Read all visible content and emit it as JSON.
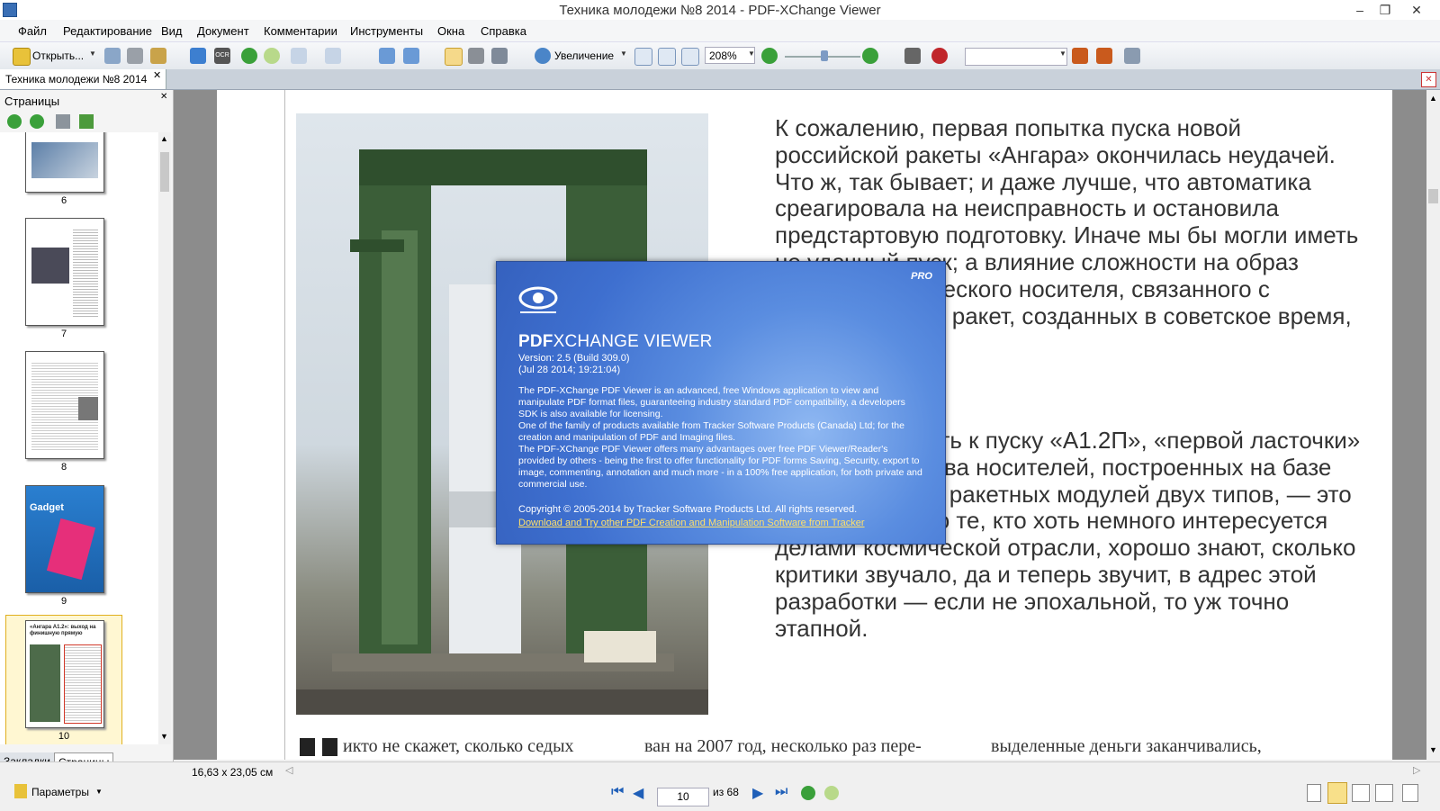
{
  "window": {
    "title": "Техника молодежи №8 2014 - PDF-XChange Viewer",
    "controls": [
      "–",
      "❐",
      "✕"
    ]
  },
  "menu": [
    "Файл",
    "Редактирование",
    "Вид",
    "Документ",
    "Комментарии",
    "Инструменты",
    "Окна",
    "Справка"
  ],
  "toolbar": {
    "open_label": "Открыть...",
    "zoom_label": "Увеличение",
    "zoom_value": "208%"
  },
  "tab": {
    "label": "Техника молодежи №8 2014"
  },
  "panel": {
    "title": "Страницы",
    "tabs": [
      "Закладки",
      "Страницы"
    ],
    "pages": [
      "6",
      "7",
      "8",
      "9",
      "10"
    ],
    "thumb9_brand": "Gadget",
    "thumb10_headline": "«Ангара А1.2»: выход на финишную прямую"
  },
  "document": {
    "paragraph1": "К сожалению, первая попытка пуска новой российской ракеты «Ангара» окончилась неудачей. Что ж, так бывает; и даже лучше, что автоматика среагировала на неисправность и остановила предстартовую подготовку. Иначе мы бы могли иметь не удачный пуск; а влияние сложности на образ первого космического носителя, связанного с модернизацией ракет, созданных в советское время, было бы",
    "paragraph2": "было, готовность к пуску «А1.2П», «первой ласточки» целого семейства носителей, построенных на базе универсальных ракетных модулей двух типов, — это прорыв. Однако те, кто хоть немного интересуется делами космической отрасли, хорошо знают, сколько критики звучало, да и теперь звучит, в адрес этой разработки — если не эпохальной, то уж точно этапной.",
    "bottom_line_1": "икто не скажет, сколько седых",
    "bottom_line_2": "ван на 2007 год, несколько раз пере-",
    "bottom_line_3": "выделенные деньги заканчивались,"
  },
  "about_dialog": {
    "badge": "PRO",
    "product_bold": "PDF",
    "product_rest": "XCHANGE VIEWER",
    "version": "Version: 2.5 (Build 309.0)",
    "build_date": "(Jul 28 2014; 19:21:04)",
    "description_1": "The PDF-XChange PDF Viewer is an advanced, free Windows application to view and manipulate PDF format files, guaranteeing industry standard PDF compatibility, a developers SDK is also available for licensing.",
    "description_2": "One of the family of products available from Tracker Software Products (Canada) Ltd; for the creation and manipulation of PDF and Imaging files.",
    "description_3": "The PDF-XChange PDF Viewer offers many advantages over free PDF Viewer/Reader's provided by others - being the first to offer functionality for PDF forms Saving, Security, export to image, commenting, annotation and much more - in a 100% free application, for both private and commercial use.",
    "copyright": "Copyright © 2005-2014 by Tracker Software Products Ltd. All rights reserved.",
    "link": "Download and Try other PDF Creation and Manipulation Software from Tracker"
  },
  "status": {
    "page_size": "16,63 x 23,05 см",
    "params_label": "Параметры",
    "current_page": "10",
    "page_of": "из 68"
  },
  "colors": {
    "link_yellow": "#ffe06a",
    "dialog_blue": "#3e6fcf"
  }
}
